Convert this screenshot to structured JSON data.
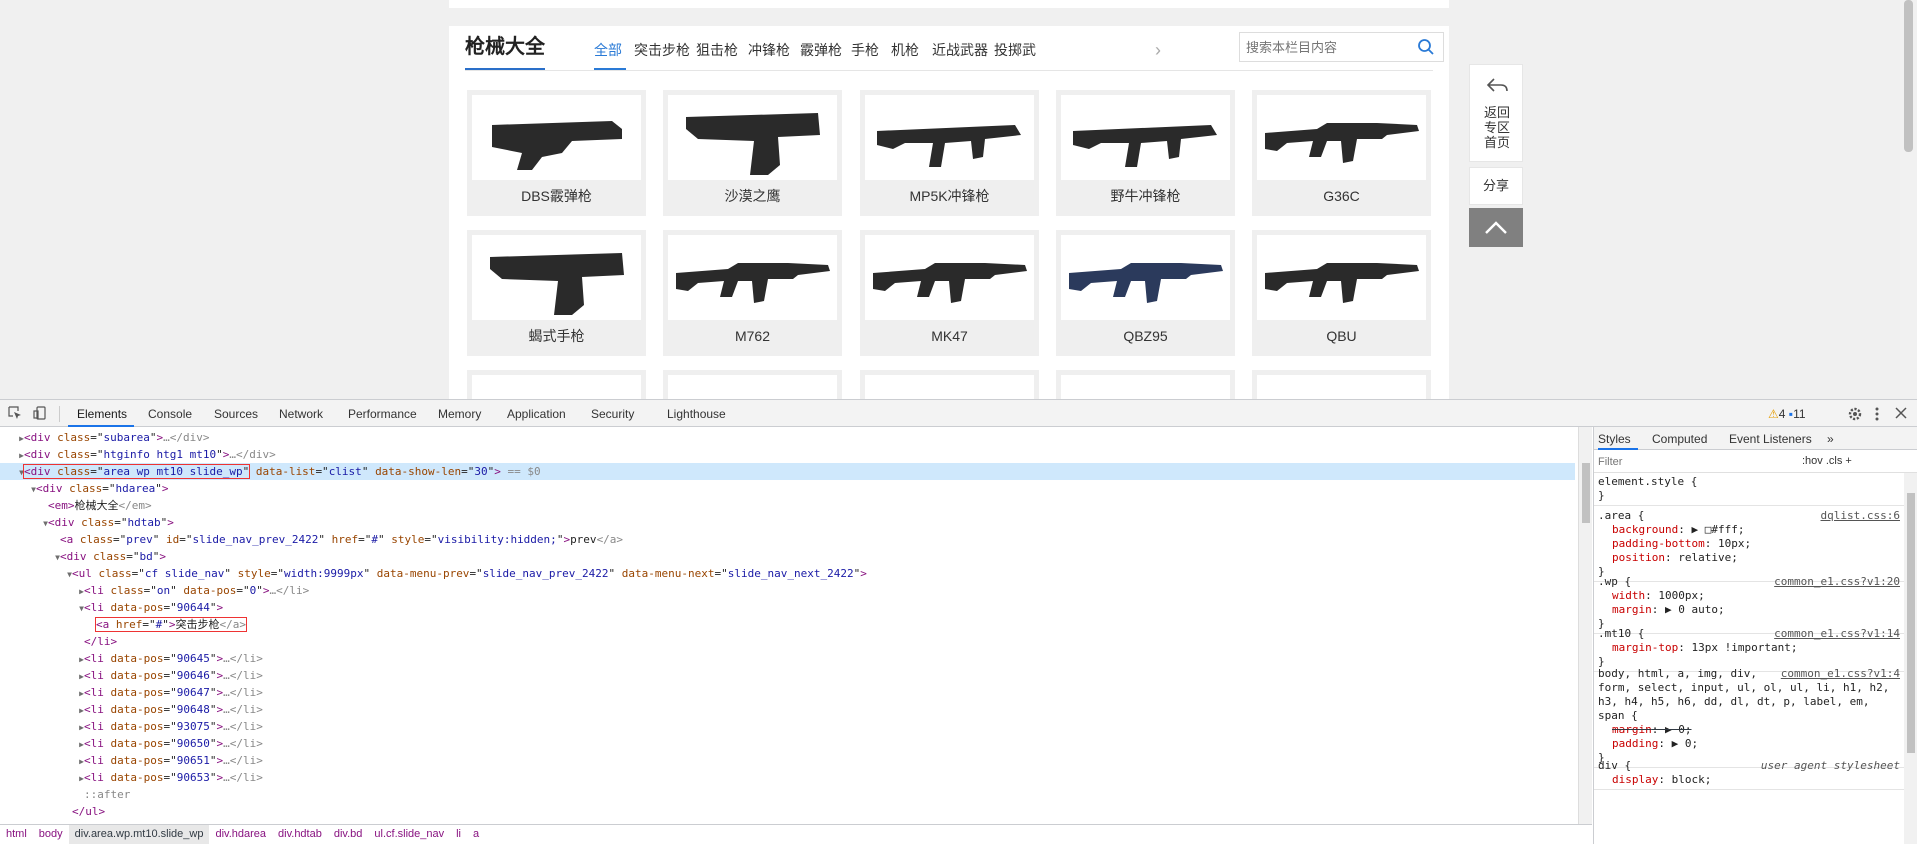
{
  "page": {
    "section_title": "枪械大全",
    "tabs": [
      "全部",
      "突击步枪",
      "狙击枪",
      "冲锋枪",
      "霰弹枪",
      "手枪",
      "机枪",
      "近战武器",
      "投掷武"
    ],
    "search_placeholder": "搜索本栏目内容",
    "weapons": [
      {
        "name": "DBS霰弹枪",
        "icon": "shotgun-image"
      },
      {
        "name": "沙漠之鹰",
        "icon": "pistol-image"
      },
      {
        "name": "MP5K冲锋枪",
        "icon": "smg-image"
      },
      {
        "name": "野牛冲锋枪",
        "icon": "smg-image"
      },
      {
        "name": "G36C",
        "icon": "rifle-image"
      },
      {
        "name": "蝎式手枪",
        "icon": "pistol-image"
      },
      {
        "name": "M762",
        "icon": "rifle-image"
      },
      {
        "name": "MK47",
        "icon": "rifle-image"
      },
      {
        "name": "QBZ95",
        "icon": "rifle-image"
      },
      {
        "name": "QBU",
        "icon": "rifle-image"
      }
    ],
    "side": {
      "back_label": "返回\n专区\n首页",
      "share_label": "分享"
    }
  },
  "devtools": {
    "tabs": [
      "Elements",
      "Console",
      "Sources",
      "Network",
      "Performance",
      "Memory",
      "Application",
      "Security",
      "Lighthouse"
    ],
    "warnings": "4",
    "messages": "11",
    "dom_lines": [
      {
        "indent": 1,
        "tri": "▶",
        "tag": "div",
        "attrs": [
          [
            "class",
            "subarea"
          ]
        ],
        "tail": "…</div>"
      },
      {
        "indent": 1,
        "tri": "▶",
        "tag": "div",
        "attrs": [
          [
            "class",
            "htginfo htg1 mt10"
          ]
        ],
        "tail": "…</div>"
      },
      {
        "indent": 1,
        "tri": "▼",
        "tag": "div",
        "attrs": [
          [
            "class",
            "area wp mt10 slide_wp"
          ],
          [
            "data-list",
            "clist"
          ],
          [
            "data-show-len",
            "30"
          ]
        ],
        "tail": "",
        "selected": true,
        "suffix": " == $0"
      },
      {
        "indent": 2,
        "tri": "▼",
        "tag": "div",
        "attrs": [
          [
            "class",
            "hdarea"
          ]
        ],
        "tail": ""
      },
      {
        "indent": 3,
        "tri": "",
        "tag": "em",
        "attrs": [],
        "text": "枪械大全",
        "tail": "</em>"
      },
      {
        "indent": 3,
        "tri": "▼",
        "tag": "div",
        "attrs": [
          [
            "class",
            "hdtab"
          ]
        ],
        "tail": ""
      },
      {
        "indent": 4,
        "tri": "",
        "tag": "a",
        "attrs": [
          [
            "class",
            "prev"
          ],
          [
            "id",
            "slide_nav_prev_2422"
          ],
          [
            "href",
            "#"
          ],
          [
            "style",
            "visibility:hidden;"
          ]
        ],
        "text": "prev",
        "tail": "</a>"
      },
      {
        "indent": 4,
        "tri": "▼",
        "tag": "div",
        "attrs": [
          [
            "class",
            "bd"
          ]
        ],
        "tail": ""
      },
      {
        "indent": 5,
        "tri": "▼",
        "tag": "ul",
        "attrs": [
          [
            "class",
            "cf slide_nav"
          ],
          [
            "style",
            "width:9999px"
          ],
          [
            "data-menu-prev",
            "slide_nav_prev_2422"
          ],
          [
            "data-menu-next",
            "slide_nav_next_2422"
          ]
        ],
        "tail": ""
      },
      {
        "indent": 6,
        "tri": "▶",
        "tag": "li",
        "attrs": [
          [
            "class",
            "on"
          ],
          [
            "data-pos",
            "0"
          ]
        ],
        "tail": "…</li>"
      },
      {
        "indent": 6,
        "tri": "▼",
        "tag": "li",
        "attrs": [
          [
            "data-pos",
            "90644"
          ]
        ],
        "tail": ""
      },
      {
        "indent": 7,
        "tri": "",
        "tag": "a",
        "attrs": [
          [
            "href",
            "#"
          ]
        ],
        "text": "突击步枪",
        "tail": "</a>",
        "boxed": true
      },
      {
        "indent": 6,
        "tri": "",
        "close": "</li>"
      },
      {
        "indent": 6,
        "tri": "▶",
        "tag": "li",
        "attrs": [
          [
            "data-pos",
            "90645"
          ]
        ],
        "tail": "…</li>"
      },
      {
        "indent": 6,
        "tri": "▶",
        "tag": "li",
        "attrs": [
          [
            "data-pos",
            "90646"
          ]
        ],
        "tail": "…</li>"
      },
      {
        "indent": 6,
        "tri": "▶",
        "tag": "li",
        "attrs": [
          [
            "data-pos",
            "90647"
          ]
        ],
        "tail": "…</li>"
      },
      {
        "indent": 6,
        "tri": "▶",
        "tag": "li",
        "attrs": [
          [
            "data-pos",
            "90648"
          ]
        ],
        "tail": "…</li>"
      },
      {
        "indent": 6,
        "tri": "▶",
        "tag": "li",
        "attrs": [
          [
            "data-pos",
            "93075"
          ]
        ],
        "tail": "…</li>"
      },
      {
        "indent": 6,
        "tri": "▶",
        "tag": "li",
        "attrs": [
          [
            "data-pos",
            "90650"
          ]
        ],
        "tail": "…</li>"
      },
      {
        "indent": 6,
        "tri": "▶",
        "tag": "li",
        "attrs": [
          [
            "data-pos",
            "90651"
          ]
        ],
        "tail": "…</li>"
      },
      {
        "indent": 6,
        "tri": "▶",
        "tag": "li",
        "attrs": [
          [
            "data-pos",
            "90653"
          ]
        ],
        "tail": "…</li>"
      },
      {
        "indent": 6,
        "tri": "",
        "pseudo": "::after"
      },
      {
        "indent": 5,
        "tri": "",
        "close": "</ul>"
      }
    ],
    "breadcrumbs": [
      "html",
      "body",
      "div.area.wp.mt10.slide_wp",
      "div.hdarea",
      "div.hdtab",
      "div.bd",
      "ul.cf.slide_nav",
      "li",
      "a"
    ],
    "styles": {
      "tabs": [
        "Styles",
        "Computed",
        "Event Listeners",
        "»"
      ],
      "filter_placeholder": "Filter",
      "filter_opts": ":hov  .cls  +",
      "rules": [
        {
          "selector": "element.style {",
          "source": "",
          "decls": [],
          "close": "}"
        },
        {
          "selector": ".area {",
          "source": "dqlist.css:6",
          "decls": [
            [
              "background",
              "▶ □#fff;"
            ],
            [
              "padding-bottom",
              "10px;"
            ],
            [
              "position",
              "relative;"
            ]
          ],
          "close": "}"
        },
        {
          "selector": ".wp {",
          "source": "common_e1.css?v1:20",
          "decls": [
            [
              "width",
              "1000px;"
            ],
            [
              "margin",
              "▶ 0 auto;"
            ]
          ],
          "close": "}"
        },
        {
          "selector": ".mt10 {",
          "source": "common_e1.css?v1:14",
          "decls": [
            [
              "margin-top",
              "13px !important;"
            ]
          ],
          "close": "}"
        },
        {
          "selector": "body, html, a, img, div,\nform, select, input, ul, ol, ul, li, h1, h2,\nh3, h4, h5, h6, dd, dl, dt, p, label, em,\nspan {",
          "source": "common_e1.css?v1:4",
          "decls": [
            [
              "margin",
              "▶ 0;",
              "strike"
            ],
            [
              "padding",
              "▶ 0;"
            ]
          ],
          "close": "}"
        },
        {
          "selector": "div {",
          "source": "user agent stylesheet",
          "decls": [
            [
              "display",
              "block;"
            ]
          ],
          "close": ""
        }
      ]
    }
  }
}
